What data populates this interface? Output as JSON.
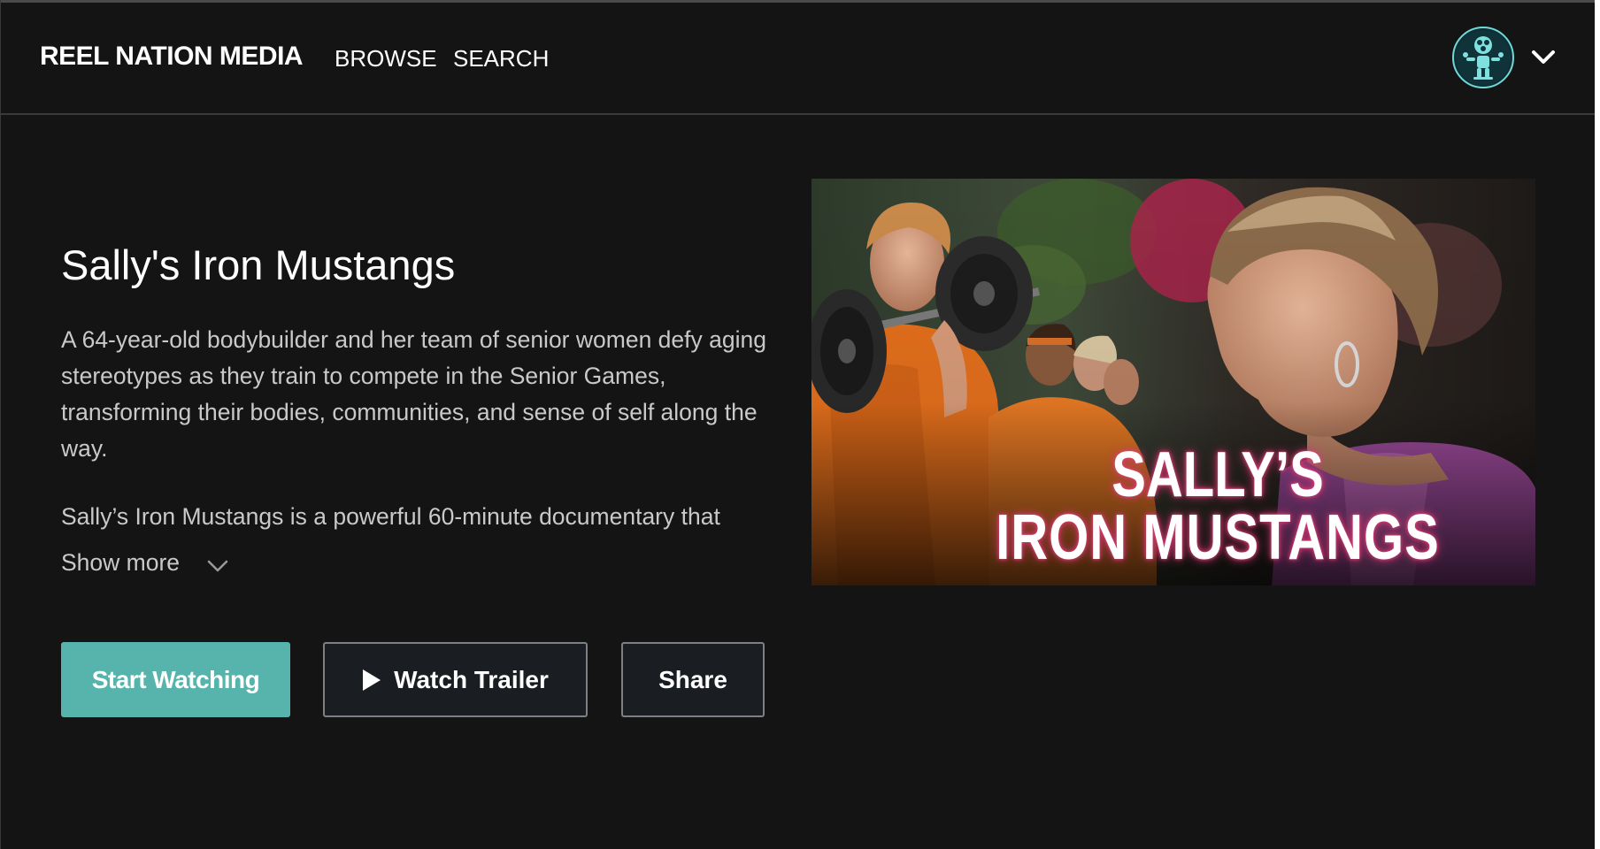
{
  "header": {
    "brand": "REEL NATION MEDIA",
    "nav": {
      "browse": "BROWSE",
      "search": "SEARCH"
    }
  },
  "film": {
    "title": "Sally's Iron Mustangs",
    "description": "A 64-year-old bodybuilder and her team of senior women defy aging stereotypes as they train to compete in the Senior Games, transforming their bodies, communities, and sense of self along the way.",
    "description_more": "Sally’s Iron Mustangs is a powerful 60-minute documentary that",
    "show_more": "Show more",
    "poster_title_line1": "SALLY’S",
    "poster_title_line2": "IRON MUSTANGS"
  },
  "actions": {
    "start_watching": "Start Watching",
    "watch_trailer": "Watch Trailer",
    "share": "Share"
  },
  "icons": {
    "avatar": "avatar-icon",
    "user_menu": "chevron-down-icon",
    "show_more": "chevron-down-icon",
    "trailer": "play-icon"
  },
  "colors": {
    "background": "#141414",
    "accent": "#56b4ac",
    "secondary_button": "#1a1e22",
    "poster_glow": "#d1336e"
  }
}
